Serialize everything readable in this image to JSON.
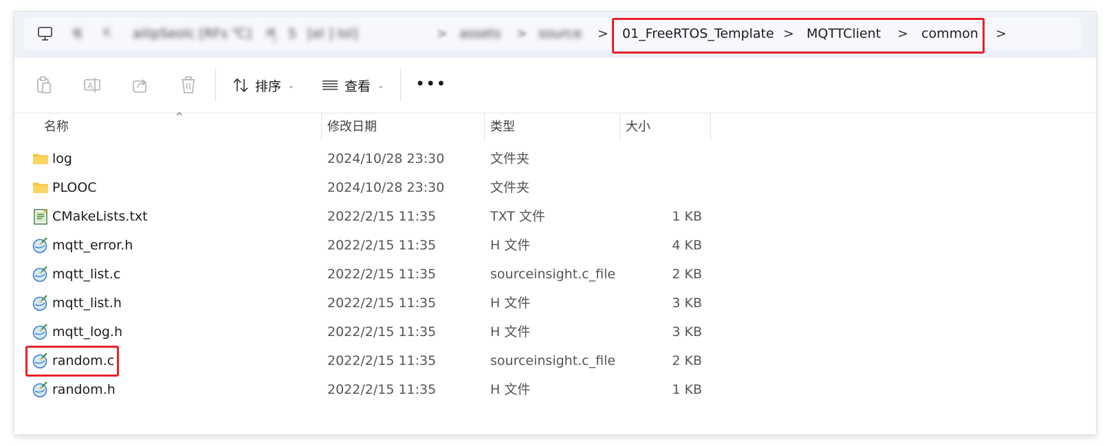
{
  "address_bar": {
    "blurred_crumbs": [
      "ཝ",
      "ང",
      "ailipSeolc [RFs ℃]",
      "ཞ",
      "5",
      "[el ] lol]",
      "assets",
      "source"
    ],
    "crumbs": [
      "01_FreeRTOS_Template",
      "MQTTClient",
      "common"
    ],
    "separator": ">"
  },
  "toolbar": {
    "sort_label": "排序",
    "view_label": "查看",
    "more_label": "•••",
    "caret": "⌄"
  },
  "columns": {
    "name": "名称",
    "date": "修改日期",
    "type": "类型",
    "size": "大小",
    "sort_indicator": "^"
  },
  "files": [
    {
      "name": "log",
      "date": "2024/10/28 23:30",
      "type": "文件夹",
      "size": "",
      "icon": "folder"
    },
    {
      "name": "PLOOC",
      "date": "2024/10/28 23:30",
      "type": "文件夹",
      "size": "",
      "icon": "folder"
    },
    {
      "name": "CMakeLists.txt",
      "date": "2022/2/15 11:35",
      "type": "TXT 文件",
      "size": "1 KB",
      "icon": "text-file"
    },
    {
      "name": "mqtt_error.h",
      "date": "2022/2/15 11:35",
      "type": "H 文件",
      "size": "4 KB",
      "icon": "source-file"
    },
    {
      "name": "mqtt_list.c",
      "date": "2022/2/15 11:35",
      "type": "sourceinsight.c_file",
      "size": "2 KB",
      "icon": "source-file"
    },
    {
      "name": "mqtt_list.h",
      "date": "2022/2/15 11:35",
      "type": "H 文件",
      "size": "3 KB",
      "icon": "source-file"
    },
    {
      "name": "mqtt_log.h",
      "date": "2022/2/15 11:35",
      "type": "H 文件",
      "size": "3 KB",
      "icon": "source-file"
    },
    {
      "name": "random.c",
      "date": "2022/2/15 11:35",
      "type": "sourceinsight.c_file",
      "size": "2 KB",
      "icon": "source-file"
    },
    {
      "name": "random.h",
      "date": "2022/2/15 11:35",
      "type": "H 文件",
      "size": "1 KB",
      "icon": "source-file"
    }
  ],
  "colors": {
    "highlight_box": "#e8202a",
    "address_bg": "#eef1f8",
    "folder": "#f6c342"
  }
}
